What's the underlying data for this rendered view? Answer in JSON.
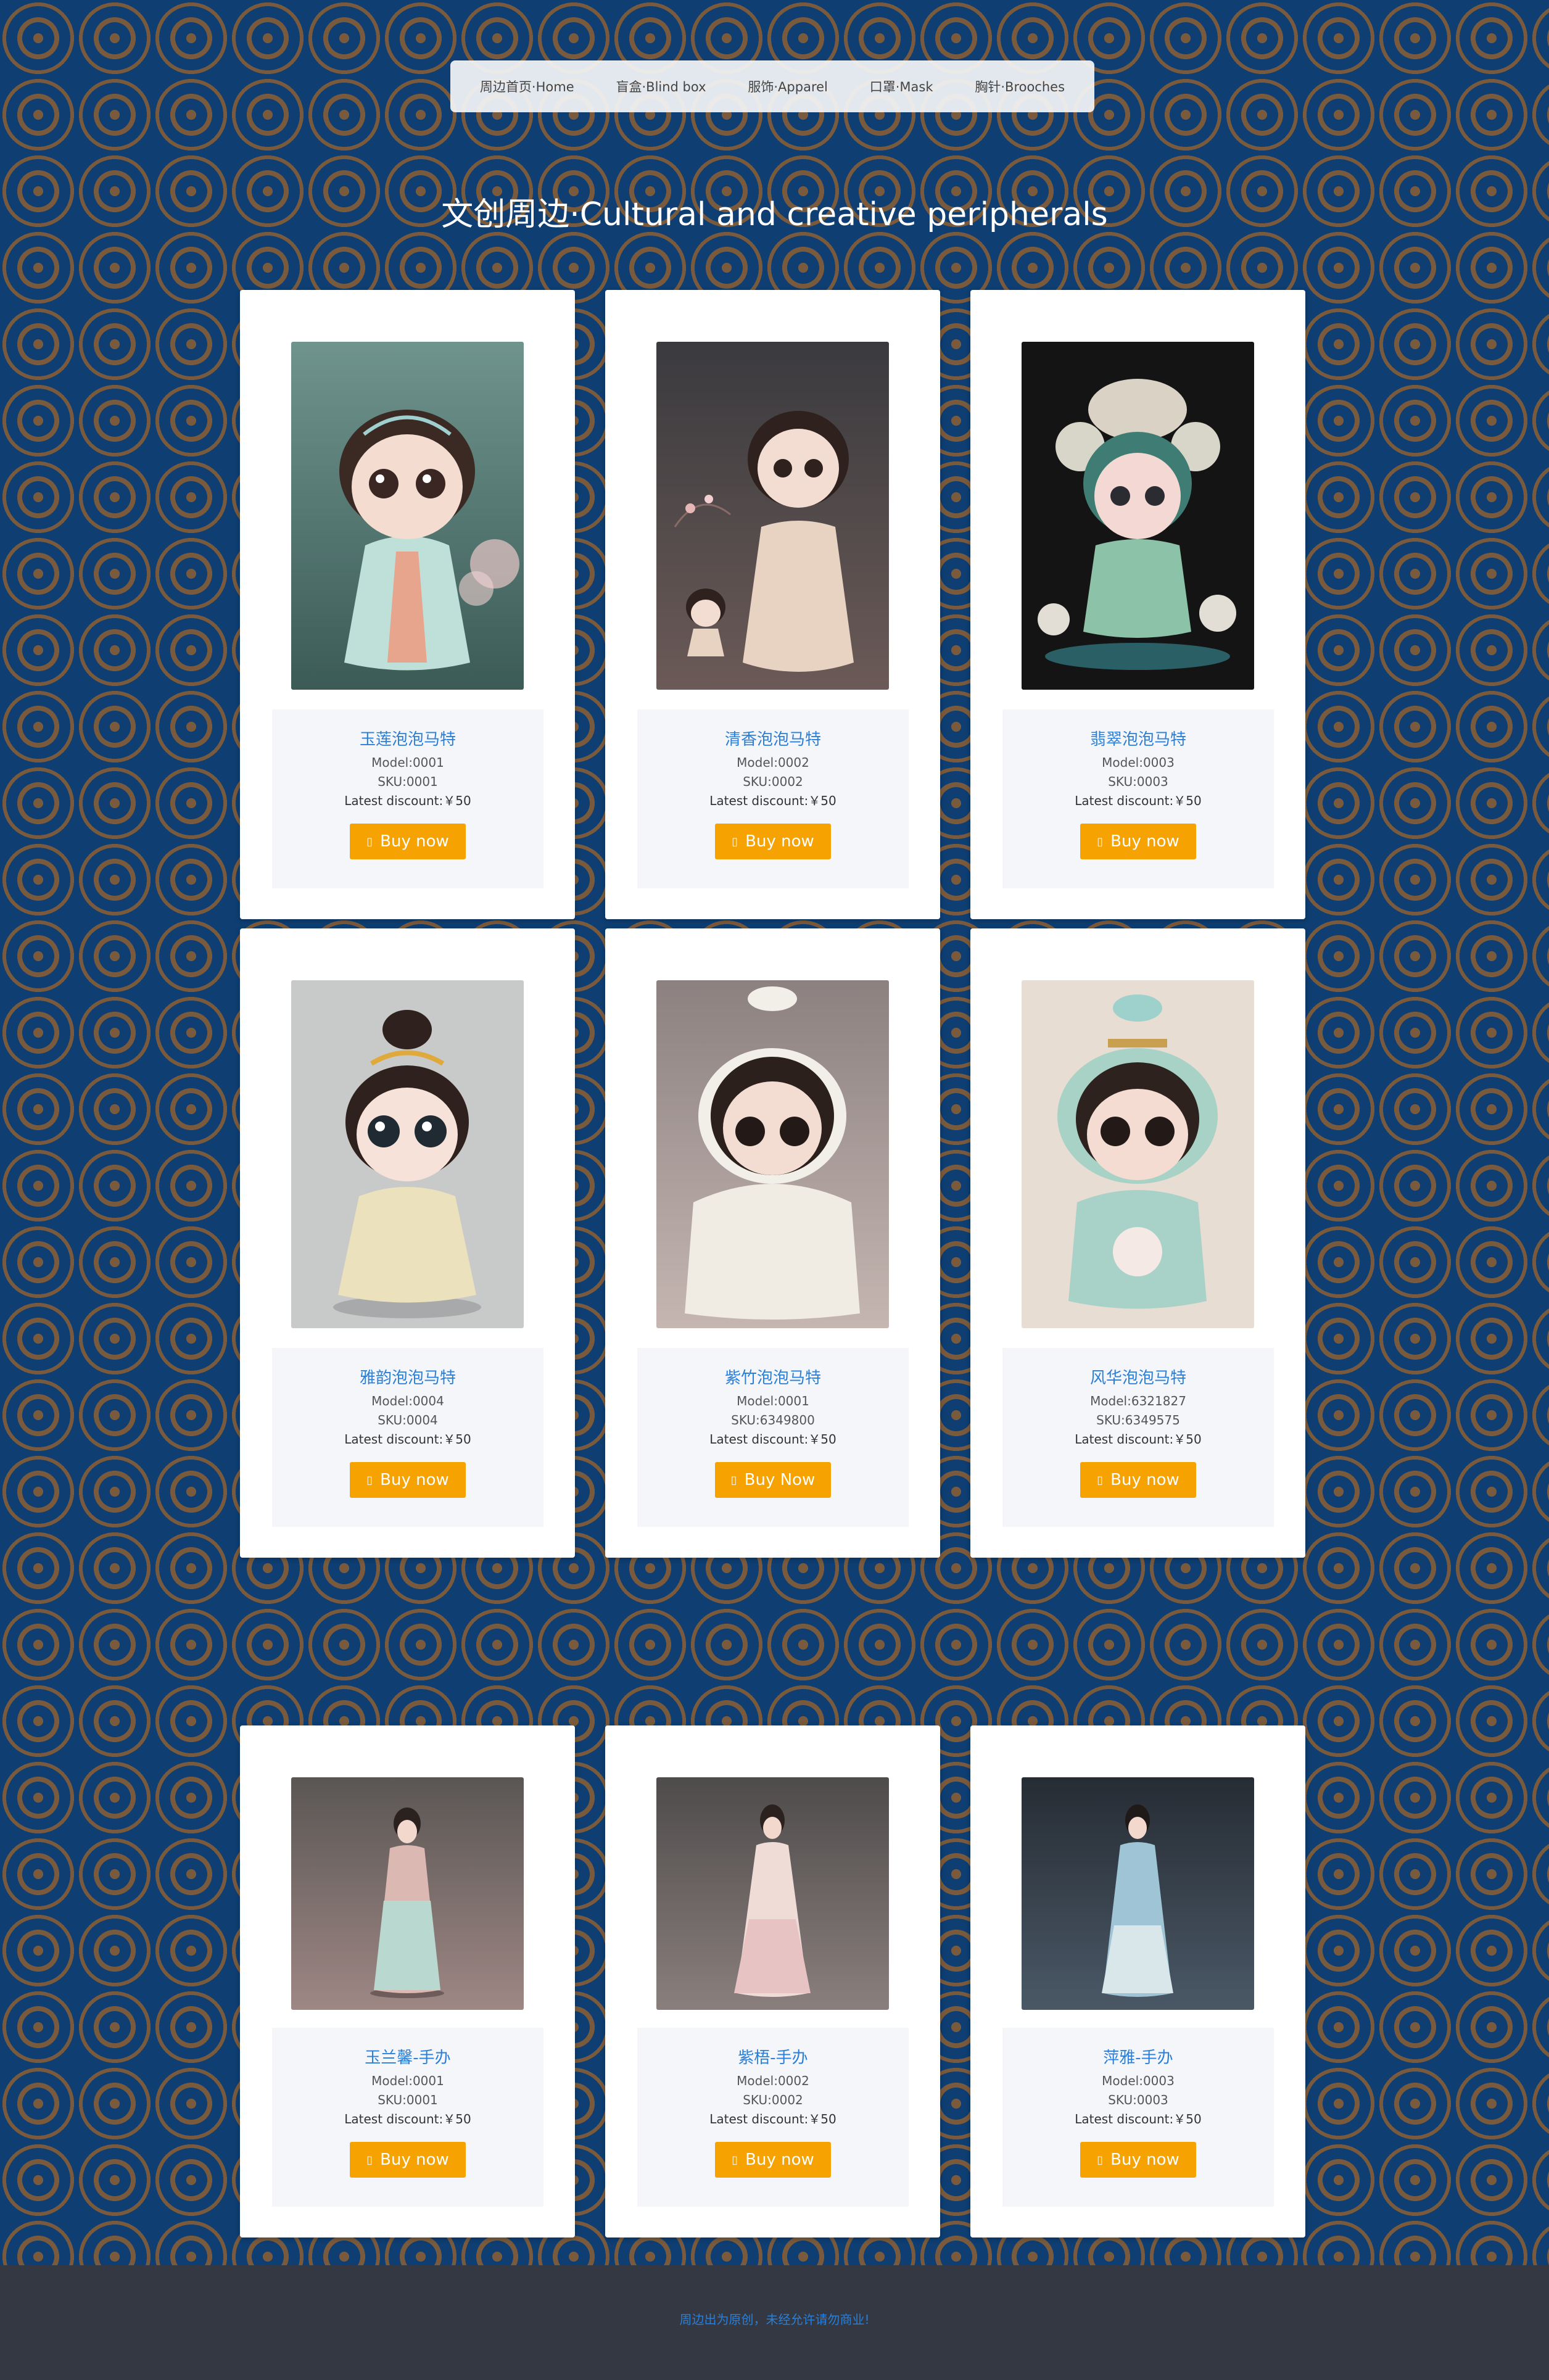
{
  "nav": {
    "items": [
      "周边首页·Home",
      "盲盒·Blind box",
      "服饰·Apparel",
      "口罩·Mask",
      "胸针·Brooches"
    ]
  },
  "page_title": "文创周边·Cultural and creative peripherals",
  "buy_label": "Buy now",
  "products": [
    {
      "name": "玉莲泡泡马特",
      "model": "Model:0001",
      "sku": "SKU:0001",
      "discount": "Latest discount:￥50",
      "buy": "Buy now"
    },
    {
      "name": "清香泡泡马特",
      "model": "Model:0002",
      "sku": "SKU:0002",
      "discount": "Latest discount:￥50",
      "buy": "Buy now"
    },
    {
      "name": "翡翠泡泡马特",
      "model": "Model:0003",
      "sku": "SKU:0003",
      "discount": "Latest discount:￥50",
      "buy": "Buy now"
    },
    {
      "name": "雅韵泡泡马特",
      "model": "Model:0004",
      "sku": "SKU:0004",
      "discount": "Latest discount:￥50",
      "buy": "Buy now"
    },
    {
      "name": "紫竹泡泡马特",
      "model": "Model:0001",
      "sku": "SKU:6349800",
      "discount": "Latest discount:￥50",
      "buy": "Buy Now"
    },
    {
      "name": "风华泡泡马特",
      "model": "Model:6321827",
      "sku": "SKU:6349575",
      "discount": "Latest discount:￥50",
      "buy": "Buy now"
    },
    {
      "name": "玉兰馨-手办",
      "model": "Model:0001",
      "sku": "SKU:0001",
      "discount": "Latest discount:￥50",
      "buy": "Buy now"
    },
    {
      "name": "紫梧-手办",
      "model": "Model:0002",
      "sku": "SKU:0002",
      "discount": "Latest discount:￥50",
      "buy": "Buy now"
    },
    {
      "name": "萍雅-手办",
      "model": "Model:0003",
      "sku": "SKU:0003",
      "discount": "Latest discount:￥50",
      "buy": "Buy now"
    }
  ],
  "footer": {
    "text": "周边出为原创，未经允许请勿商业!"
  },
  "colors": {
    "background": "#0e3e72",
    "ring": "#7a5a3c",
    "accent": "#f6a200",
    "link": "#2a7fd9",
    "footer": "#333842"
  },
  "icons": {
    "buy": "cart-icon"
  }
}
